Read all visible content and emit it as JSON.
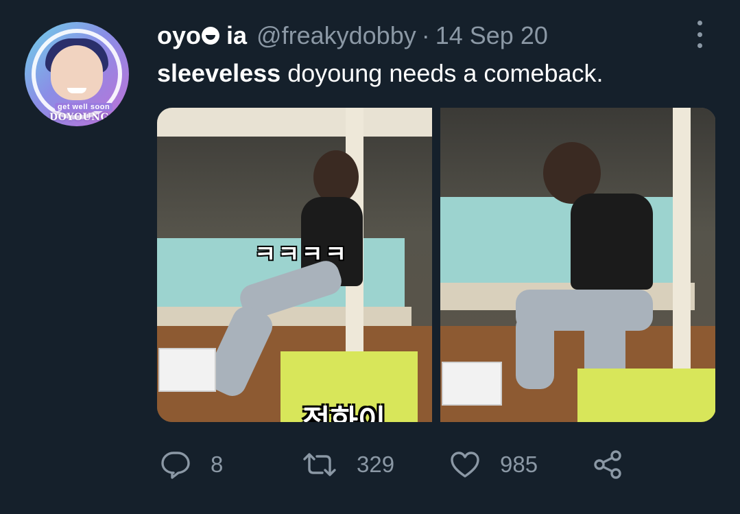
{
  "tweet": {
    "display_name_part1": "oyo",
    "display_name_emoji": "smiley-icon",
    "display_name_part2": "ia",
    "handle": "@freakydobby",
    "separator": "·",
    "date": "14 Sep 20",
    "text_bold": "sleeveless",
    "text_rest": " doyoung needs a comeback."
  },
  "avatar": {
    "caption_top": "get well soon",
    "caption_bottom": "DOYOUNG"
  },
  "media": {
    "left_caption": "ㅋㅋㅋㅋ",
    "left_bottom_caption": "정화이"
  },
  "actions": {
    "replies": "8",
    "retweets": "329",
    "likes": "985"
  },
  "icons": {
    "reply": "reply-icon",
    "retweet": "retweet-icon",
    "like": "heart-icon",
    "share": "share-icon",
    "more": "more-options-icon"
  },
  "colors": {
    "background": "#15202b",
    "text_primary": "#ffffff",
    "text_secondary": "#8b98a5"
  }
}
